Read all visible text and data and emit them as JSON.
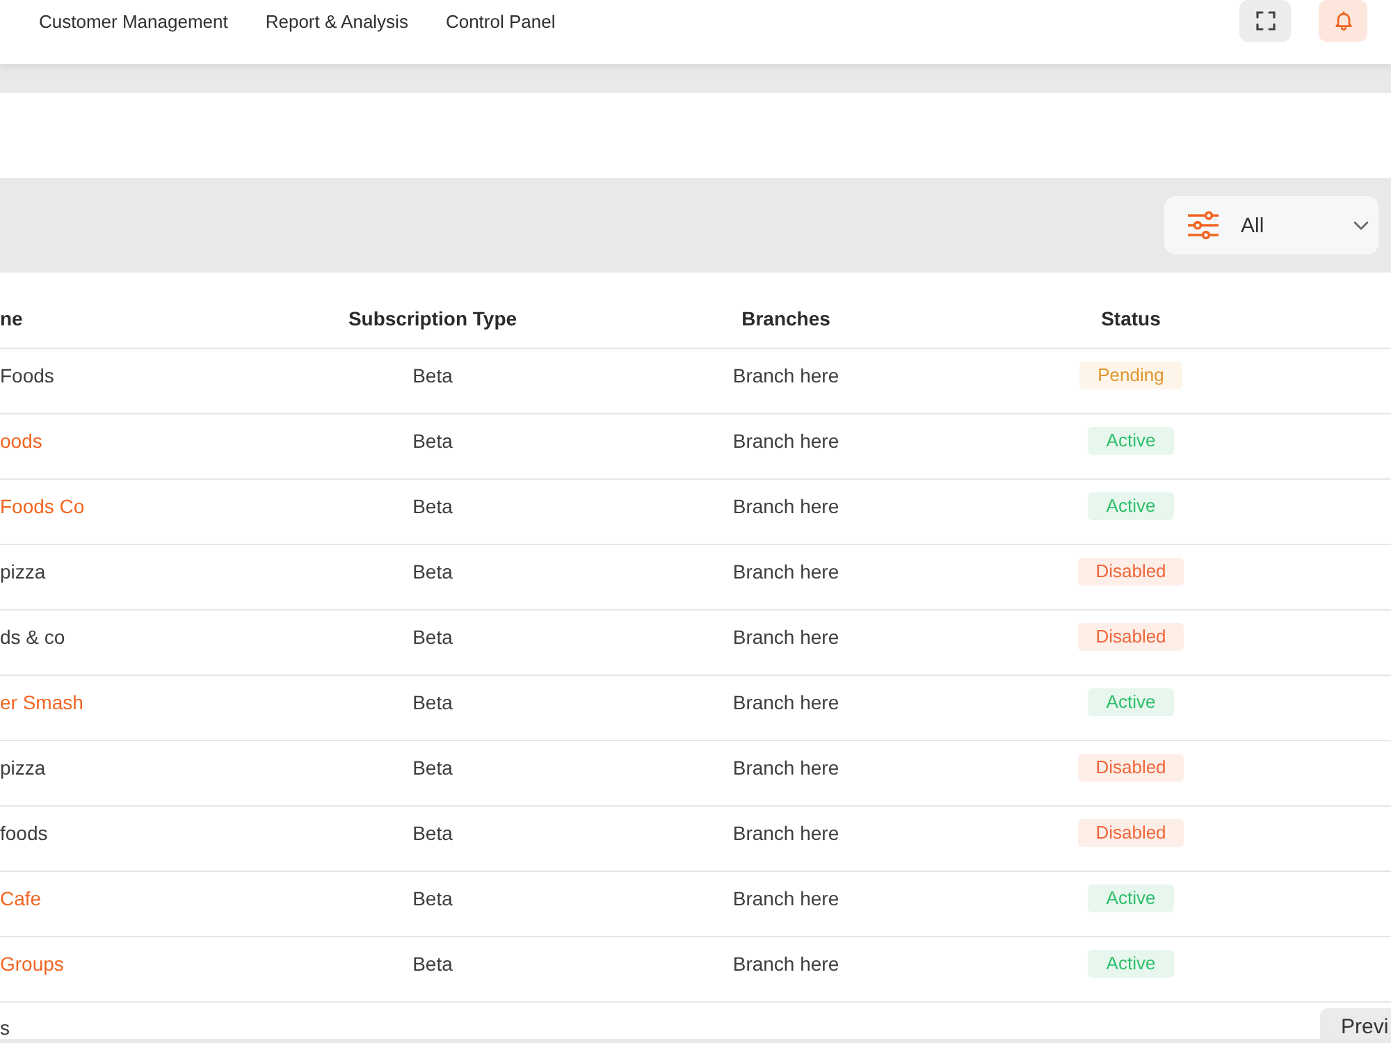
{
  "nav": {
    "items": [
      "Customer Management",
      "Report & Analysis",
      "Control Panel"
    ]
  },
  "filter": {
    "value": "All"
  },
  "table": {
    "columns": [
      "ne",
      "Subscription Type",
      "Branches",
      "Status"
    ],
    "rows": [
      {
        "name": {
          "text": "Foods",
          "color": "#3d3d3d"
        },
        "subscription": "Beta",
        "branches": "Branch here",
        "status": {
          "label": "Pending",
          "kind": "pending"
        }
      },
      {
        "name": {
          "text": "oods",
          "color": "#f26522"
        },
        "subscription": "Beta",
        "branches": "Branch here",
        "status": {
          "label": "Active",
          "kind": "active"
        }
      },
      {
        "name": {
          "text": "Foods Co",
          "color": "#f26522"
        },
        "subscription": "Beta",
        "branches": "Branch here",
        "status": {
          "label": "Active",
          "kind": "active"
        }
      },
      {
        "name": {
          "text": "pizza",
          "color": "#3d3d3d"
        },
        "subscription": "Beta",
        "branches": "Branch here",
        "status": {
          "label": "Disabled",
          "kind": "disabled"
        }
      },
      {
        "name": {
          "text": "ds & co",
          "color": "#3d3d3d"
        },
        "subscription": "Beta",
        "branches": "Branch here",
        "status": {
          "label": "Disabled",
          "kind": "disabled"
        }
      },
      {
        "name": {
          "text": "er Smash",
          "color": "#f26522"
        },
        "subscription": "Beta",
        "branches": "Branch here",
        "status": {
          "label": "Active",
          "kind": "active"
        }
      },
      {
        "name": {
          "text": "pizza",
          "color": "#3d3d3d"
        },
        "subscription": "Beta",
        "branches": "Branch here",
        "status": {
          "label": "Disabled",
          "kind": "disabled"
        }
      },
      {
        "name": {
          "text": "foods",
          "color": "#3d3d3d"
        },
        "subscription": "Beta",
        "branches": "Branch here",
        "status": {
          "label": "Disabled",
          "kind": "disabled"
        }
      },
      {
        "name": {
          "text": "Cafe",
          "color": "#f26522"
        },
        "subscription": "Beta",
        "branches": "Branch here",
        "status": {
          "label": "Active",
          "kind": "active"
        }
      },
      {
        "name": {
          "text": "Groups",
          "color": "#f26522"
        },
        "subscription": "Beta",
        "branches": "Branch here",
        "status": {
          "label": "Active",
          "kind": "active"
        }
      }
    ]
  },
  "footer": {
    "info": "s",
    "button": "Previ"
  }
}
